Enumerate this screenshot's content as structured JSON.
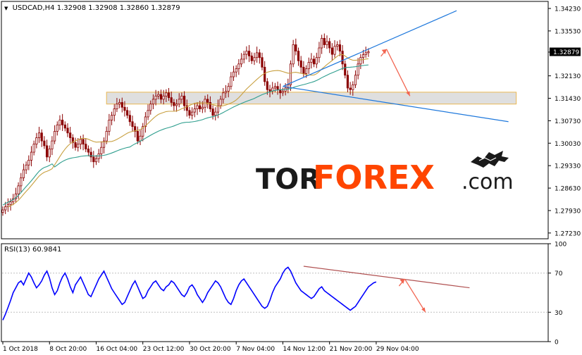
{
  "window": {
    "symbol_header": "USDCAD,H4  1.32908 1.32908 1.32860 1.32879",
    "dropdown_glyph": "▼"
  },
  "watermark": {
    "prefix": "TOR",
    "brand": "FOREX",
    "suffix": ".com",
    "logo": "bull-bear-icon"
  },
  "colors": {
    "background": "#ffffff",
    "frame": "#000000",
    "grid": "#c0c0c0",
    "candle": "#8b0000",
    "ma_fast": "#c8a040",
    "ma_slow": "#2e9e8e",
    "trendline": "#1e78dc",
    "arrow": "#f26450",
    "zone_fill": "#dcdcdc",
    "zone_border": "#e8b040",
    "rsi_line": "#0000ff",
    "rsi_trend": "#b05050",
    "price_tag_bg": "#000000",
    "price_tag_text": "#ffffff",
    "brand_dark": "#1a1a1a",
    "brand_accent": "#ff4500"
  },
  "chart_data": [
    {
      "type": "candlestick",
      "series": [
        {
          "name": "USDCAD,H4",
          "kind": "candles",
          "close": [
            1.2795,
            1.2805,
            1.2812,
            1.282,
            1.283,
            1.2845,
            1.287,
            1.2895,
            1.292,
            1.2935,
            1.295,
            1.2975,
            1.3,
            1.302,
            1.3035,
            1.301,
            1.2995,
            1.296,
            1.2985,
            1.301,
            1.304,
            1.306,
            1.3075,
            1.306,
            1.305,
            1.3035,
            1.302,
            1.3005,
            1.299,
            1.3,
            1.3015,
            1.3,
            1.2985,
            1.2975,
            1.296,
            1.2945,
            1.2955,
            1.297,
            1.299,
            1.301,
            1.304,
            1.3075,
            1.309,
            1.311,
            1.3125,
            1.313,
            1.3115,
            1.3105,
            1.309,
            1.307,
            1.3055,
            1.304,
            1.301,
            1.3025,
            1.3055,
            1.3085,
            1.3105,
            1.3125,
            1.314,
            1.315,
            1.3155,
            1.314,
            1.315,
            1.316,
            1.3145,
            1.313,
            1.312,
            1.3125,
            1.314,
            1.315,
            1.312,
            1.3105,
            1.309,
            1.31,
            1.311,
            1.312,
            1.311,
            1.3115,
            1.314,
            1.313,
            1.311,
            1.309,
            1.31,
            1.312,
            1.314,
            1.316,
            1.3165,
            1.318,
            1.321,
            1.3225,
            1.3235,
            1.325,
            1.3265,
            1.328,
            1.329,
            1.3275,
            1.326,
            1.327,
            1.3285,
            1.327,
            1.324,
            1.3195,
            1.317,
            1.3165,
            1.3175,
            1.318,
            1.317,
            1.316,
            1.3165,
            1.3175,
            1.3185,
            1.325,
            1.331,
            1.329,
            1.326,
            1.324,
            1.322,
            1.3235,
            1.3255,
            1.3265,
            1.325,
            1.327,
            1.33,
            1.333,
            1.331,
            1.332,
            1.33,
            1.328,
            1.3305,
            1.331,
            1.329,
            1.325,
            1.3215,
            1.3175,
            1.317,
            1.3185,
            1.3215,
            1.325,
            1.327,
            1.3279,
            1.3285,
            1.3288
          ]
        },
        {
          "name": "MA fast",
          "kind": "line"
        },
        {
          "name": "MA slow",
          "kind": "line"
        }
      ],
      "y_ticks": [
        1.3423,
        1.3353,
        1.3287,
        1.3213,
        1.3143,
        1.3073,
        1.3003,
        1.2933,
        1.2863,
        1.2793,
        1.2723
      ],
      "y_tick_labels": [
        "1.34230",
        "1.33530",
        "1.32870",
        "1.32130",
        "1.31430",
        "1.30730",
        "1.30030",
        "1.29330",
        "1.28630",
        "1.27930",
        "1.27230"
      ],
      "current_price": "1.32879",
      "ylim": [
        1.2705,
        1.3445
      ],
      "trendline_upper": [
        [
          108,
          1.318
        ],
        [
          175,
          1.3416
        ]
      ],
      "trendline_lower": [
        [
          108,
          1.318
        ],
        [
          195,
          1.307
        ]
      ],
      "support_zone": [
        1.3125,
        1.3162
      ],
      "forecast_arrow": [
        [
          148,
          1.3296
        ],
        [
          157,
          1.315
        ]
      ],
      "grid": false
    },
    {
      "type": "line",
      "title": "RSI(13) 60.9841",
      "series": [
        {
          "name": "RSI(13)",
          "values": [
            22,
            28,
            35,
            42,
            50,
            55,
            60,
            62,
            58,
            64,
            70,
            66,
            60,
            55,
            58,
            62,
            68,
            72,
            65,
            55,
            48,
            52,
            60,
            66,
            70,
            64,
            56,
            50,
            58,
            62,
            66,
            60,
            54,
            48,
            46,
            52,
            58,
            64,
            68,
            72,
            66,
            60,
            54,
            50,
            46,
            42,
            38,
            40,
            46,
            52,
            58,
            62,
            56,
            50,
            44,
            46,
            52,
            56,
            60,
            62,
            58,
            54,
            52,
            56,
            58,
            62,
            60,
            56,
            52,
            48,
            46,
            50,
            56,
            58,
            54,
            48,
            44,
            40,
            44,
            50,
            54,
            58,
            62,
            60,
            56,
            50,
            44,
            40,
            38,
            44,
            52,
            58,
            62,
            64,
            60,
            56,
            52,
            48,
            44,
            40,
            36,
            34,
            36,
            42,
            50,
            56,
            60,
            64,
            70,
            74,
            76,
            72,
            66,
            60,
            56,
            52,
            50,
            48,
            46,
            44,
            46,
            50,
            54,
            56,
            52,
            50,
            48,
            46,
            44,
            42,
            40,
            38,
            36,
            34,
            32,
            34,
            36,
            40,
            44,
            48,
            52,
            56,
            58,
            60,
            61
          ]
        }
      ],
      "y_ticks": [
        100,
        70,
        30,
        0
      ],
      "y_tick_labels": [
        "100",
        "70",
        "30",
        "0"
      ],
      "ylim": [
        0,
        100
      ],
      "levels": [
        70,
        30
      ],
      "trendline": [
        [
          116,
          77
        ],
        [
          180,
          55
        ]
      ],
      "forecast_arrow": [
        [
          155,
          64
        ],
        [
          163,
          30
        ]
      ],
      "x_tick_labels": [
        "1 Oct 2018",
        "8 Oct 20:00",
        "16 Oct 04:00",
        "23 Oct 12:00",
        "30 Oct 20:00",
        "7 Nov 04:00",
        "14 Nov 12:00",
        "21 Nov 20:00",
        "29 Nov 04:00"
      ],
      "x_tick_index": [
        0,
        18,
        36,
        54,
        72,
        90,
        108,
        126,
        144
      ],
      "xlim": [
        0,
        225
      ]
    }
  ]
}
